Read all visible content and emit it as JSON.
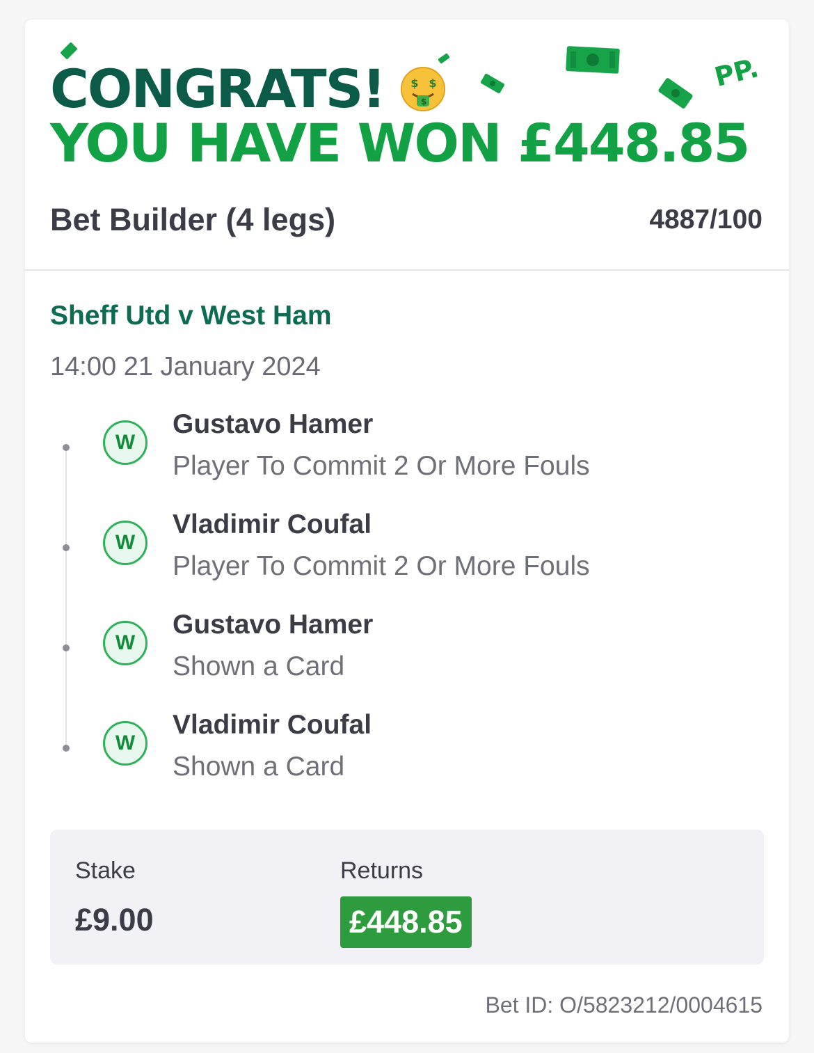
{
  "header": {
    "congrats": "CONGRATS!",
    "won_text": "YOU HAVE WON £448.85",
    "logo": "PP."
  },
  "bet": {
    "title": "Bet Builder (4 legs)",
    "odds": "4887/100"
  },
  "event": {
    "title": "Sheff Utd v West Ham",
    "datetime": "14:00 21 January 2024"
  },
  "legs": [
    {
      "result": "W",
      "player": "Gustavo Hamer",
      "market": "Player To Commit 2 Or More Fouls"
    },
    {
      "result": "W",
      "player": "Vladimir Coufal",
      "market": "Player To Commit 2 Or More Fouls"
    },
    {
      "result": "W",
      "player": "Gustavo Hamer",
      "market": "Shown a Card"
    },
    {
      "result": "W",
      "player": "Vladimir Coufal",
      "market": "Shown a Card"
    }
  ],
  "summary": {
    "stake_label": "Stake",
    "stake_value": "£9.00",
    "returns_label": "Returns",
    "returns_value": "£448.85"
  },
  "bet_id": "Bet ID: O/5823212/0004615",
  "colors": {
    "brand_dark_green": "#0c5a48",
    "brand_green": "#13a145",
    "returns_bg": "#2e9b3e"
  },
  "icons": [
    "money-mouth-face-icon",
    "banknote-icon",
    "win-badge-icon"
  ]
}
